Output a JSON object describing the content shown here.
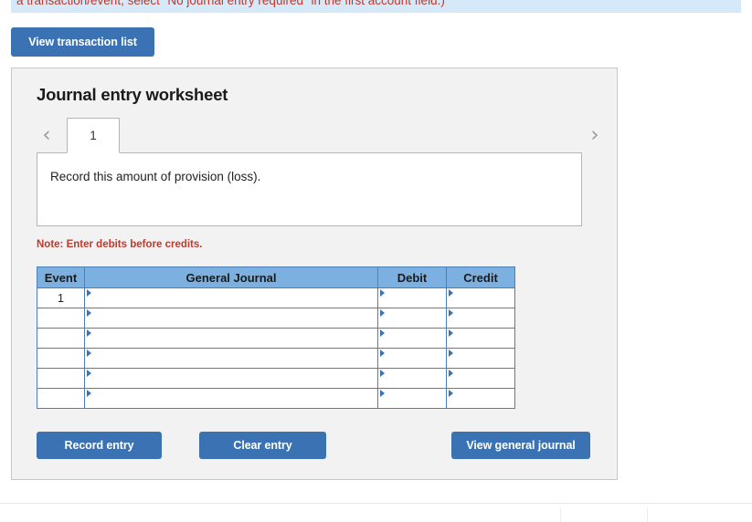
{
  "banner": {
    "text": "a transaction/event, select \"No journal entry required\" in the first account field.)",
    "background_color": "#d6e9f8",
    "text_color": "#c0392b"
  },
  "toolbar": {
    "view_transaction_list_label": "View transaction list"
  },
  "panel": {
    "title": "Journal entry worksheet",
    "background_color": "#f2f2f2"
  },
  "tabs": {
    "prev_icon": "chevron-left-icon",
    "next_icon": "chevron-right-icon",
    "prev_glyph": "‹",
    "next_glyph": "›",
    "items": [
      {
        "label": "1",
        "active": true
      }
    ]
  },
  "prompt": {
    "text": "Record this amount of provision (loss)."
  },
  "note": {
    "text": "Note: Enter debits before credits."
  },
  "journal_table": {
    "header_color": "#7cb0e0",
    "border_color": "#4b7fb5",
    "columns": [
      "Event",
      "General Journal",
      "Debit",
      "Credit"
    ],
    "rows": [
      {
        "event": "1",
        "general_journal": "",
        "debit": "",
        "credit": ""
      },
      {
        "event": "",
        "general_journal": "",
        "debit": "",
        "credit": ""
      },
      {
        "event": "",
        "general_journal": "",
        "debit": "",
        "credit": ""
      },
      {
        "event": "",
        "general_journal": "",
        "debit": "",
        "credit": ""
      },
      {
        "event": "",
        "general_journal": "",
        "debit": "",
        "credit": ""
      },
      {
        "event": "",
        "general_journal": "",
        "debit": "",
        "credit": ""
      }
    ]
  },
  "actions": {
    "record_entry_label": "Record entry",
    "clear_entry_label": "Clear entry",
    "view_general_journal_label": "View general journal",
    "button_color": "#3b72b4"
  }
}
